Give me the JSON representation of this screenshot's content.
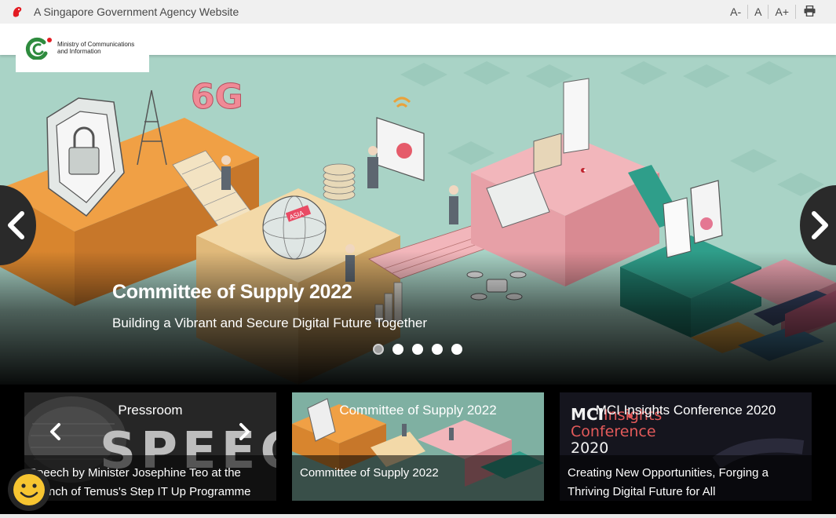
{
  "gov_bar": {
    "text": "A Singapore Government Agency Website",
    "font_decrease": "A-",
    "font_reset": "A",
    "font_increase": "A+"
  },
  "logo": {
    "line1": "Ministry of Communications",
    "line2": "and Information"
  },
  "hero": {
    "title": "Committee of Supply 2022",
    "subtitle": "Building a Vibrant and Secure Digital Future Together",
    "slide_count": 5,
    "active_slide": 1,
    "art_labels": {
      "badge_6g": "6G",
      "asia": "ASIA"
    }
  },
  "cards": [
    {
      "title": "Pressroom",
      "description": "Speech by Minister Josephine Teo at the Launch of Temus's Step IT Up Programme",
      "image_word": "SPEECH"
    },
    {
      "title": "Committee of Supply 2022",
      "description": "Committee of Supply 2022"
    },
    {
      "title": "MCI Insights Conference 2020",
      "description": "Creating New Opportunities, Forging a Thriving Digital Future for All",
      "image_lines": [
        "MCI",
        "Insights",
        "Conference",
        "2020"
      ]
    }
  ],
  "colors": {
    "hero_bg": "#a9d3c6",
    "accent_red": "#e31c23",
    "logo_green": "#2e8b3e"
  }
}
